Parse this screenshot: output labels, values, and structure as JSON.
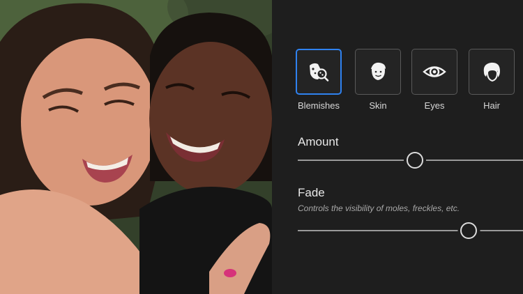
{
  "tools": [
    {
      "label": "Blemishes",
      "icon": "blemishes-icon",
      "selected": true
    },
    {
      "label": "Skin",
      "icon": "skin-face-icon",
      "selected": false
    },
    {
      "label": "Eyes",
      "icon": "eye-icon",
      "selected": false
    },
    {
      "label": "Hair",
      "icon": "hair-icon",
      "selected": false
    }
  ],
  "controls": {
    "amount": {
      "title": "Amount",
      "value": 0.52
    },
    "fade": {
      "title": "Fade",
      "description": "Controls the visibility of moles, freckles, etc.",
      "value": 0.76
    }
  },
  "colors": {
    "accent": "#2f82f0",
    "panel_bg": "#1e1e1e"
  }
}
